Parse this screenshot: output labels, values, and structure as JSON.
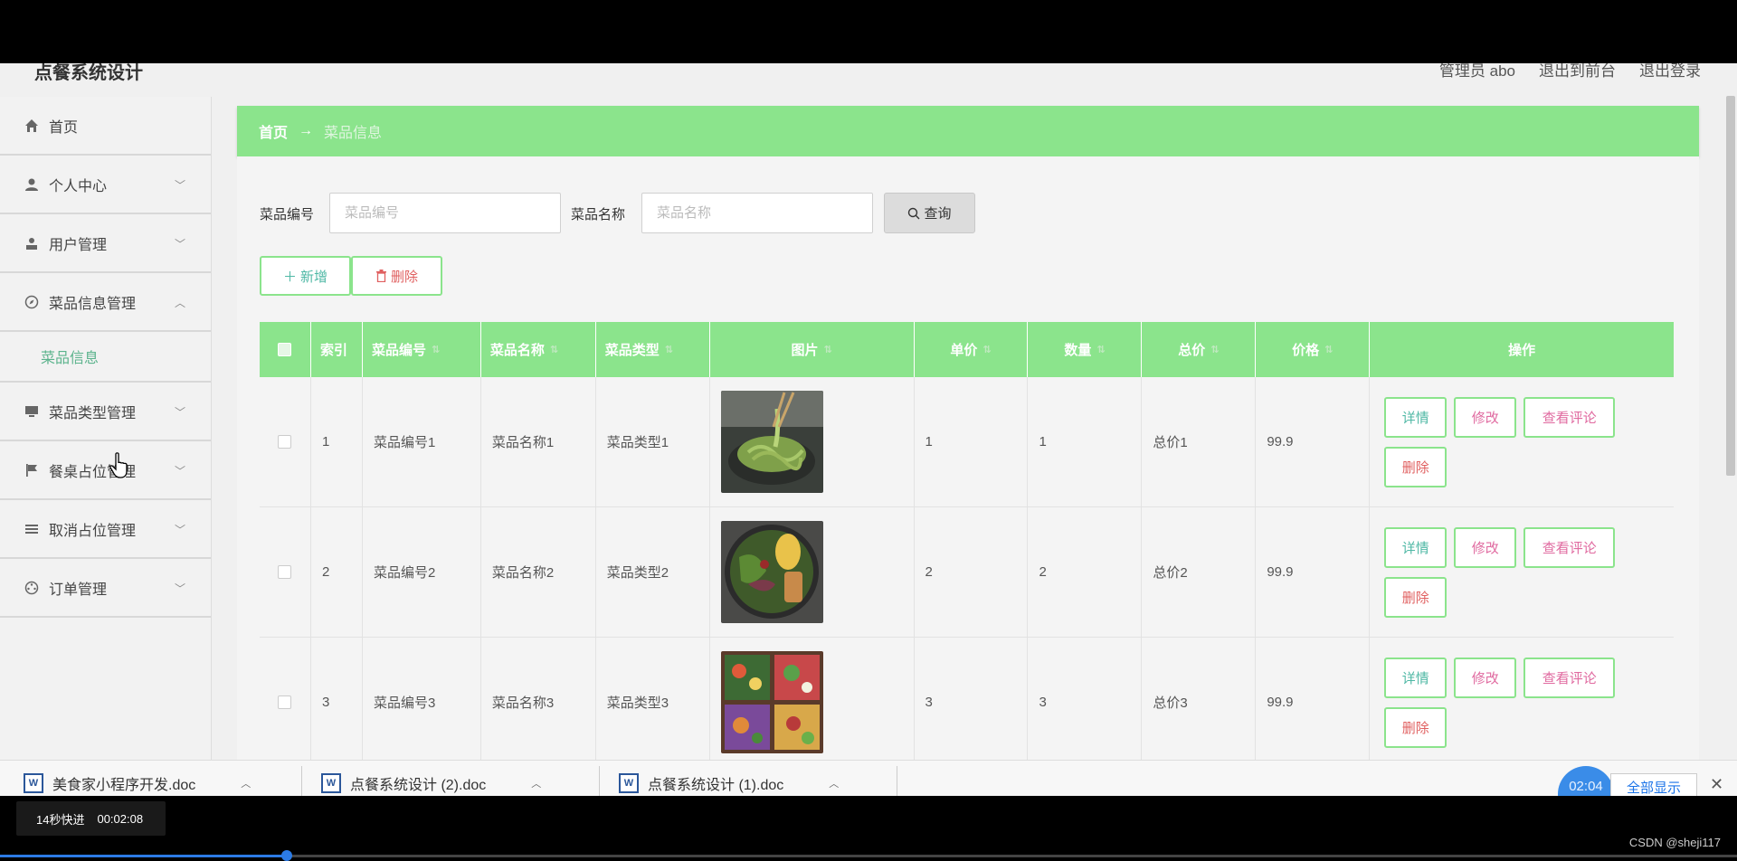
{
  "header": {
    "title": "点餐系统设计",
    "admin": "管理员 abo",
    "back_front": "退出到前台",
    "logout": "退出登录"
  },
  "sidebar": {
    "items": [
      {
        "label": "首页",
        "icon": "home-icon"
      },
      {
        "label": "个人中心",
        "icon": "person-icon"
      },
      {
        "label": "用户管理",
        "icon": "user-icon"
      },
      {
        "label": "菜品信息管理",
        "icon": "compass-icon",
        "expanded": true
      },
      {
        "label": "菜品类型管理",
        "icon": "monitor-icon"
      },
      {
        "label": "餐桌占位管理",
        "icon": "flag-icon"
      },
      {
        "label": "取消占位管理",
        "icon": "list-icon"
      },
      {
        "label": "订单管理",
        "icon": "dial-icon"
      }
    ],
    "submenu": "菜品信息"
  },
  "breadcrumb": {
    "home": "首页",
    "arrow": "→",
    "current": "菜品信息"
  },
  "search": {
    "code_label": "菜品编号",
    "code_placeholder": "菜品编号",
    "name_label": "菜品名称",
    "name_placeholder": "菜品名称",
    "button": "查询"
  },
  "actions": {
    "add": "新增",
    "delete": "删除"
  },
  "table": {
    "headers": [
      "索引",
      "菜品编号",
      "菜品名称",
      "菜品类型",
      "图片",
      "单价",
      "数量",
      "总价",
      "价格",
      "操作"
    ],
    "rows": [
      {
        "index": "1",
        "code": "菜品编号1",
        "name": "菜品名称1",
        "type": "菜品类型1",
        "image": "noodles-photo",
        "unit_price": "1",
        "qty": "1",
        "total": "总价1",
        "price": "99.9"
      },
      {
        "index": "2",
        "code": "菜品编号2",
        "name": "菜品名称2",
        "type": "菜品类型2",
        "image": "salad-plate-photo",
        "unit_price": "2",
        "qty": "2",
        "total": "总价2",
        "price": "99.9"
      },
      {
        "index": "3",
        "code": "菜品编号3",
        "name": "菜品名称3",
        "type": "菜品类型3",
        "image": "bento-box-photo",
        "unit_price": "3",
        "qty": "3",
        "total": "总价3",
        "price": "99.9"
      }
    ],
    "ops": {
      "detail": "详情",
      "edit": "修改",
      "comments": "查看评论",
      "remove": "删除"
    }
  },
  "downloads": {
    "items": [
      "美食家小程序开发.doc",
      "点餐系统设计 (2).doc",
      "点餐系统设计 (1).doc"
    ],
    "timer": "02:04",
    "show_all": "全部显示"
  },
  "video": {
    "speed_label": "14秒快进",
    "time": "00:02:08",
    "progress": 0.165,
    "watermark": "CSDN @sheji117"
  },
  "colors": {
    "accent_green": "#8be48c",
    "teal_text": "#4fb8a5",
    "pink_text": "#e06aa0",
    "red_text": "#e06060"
  }
}
